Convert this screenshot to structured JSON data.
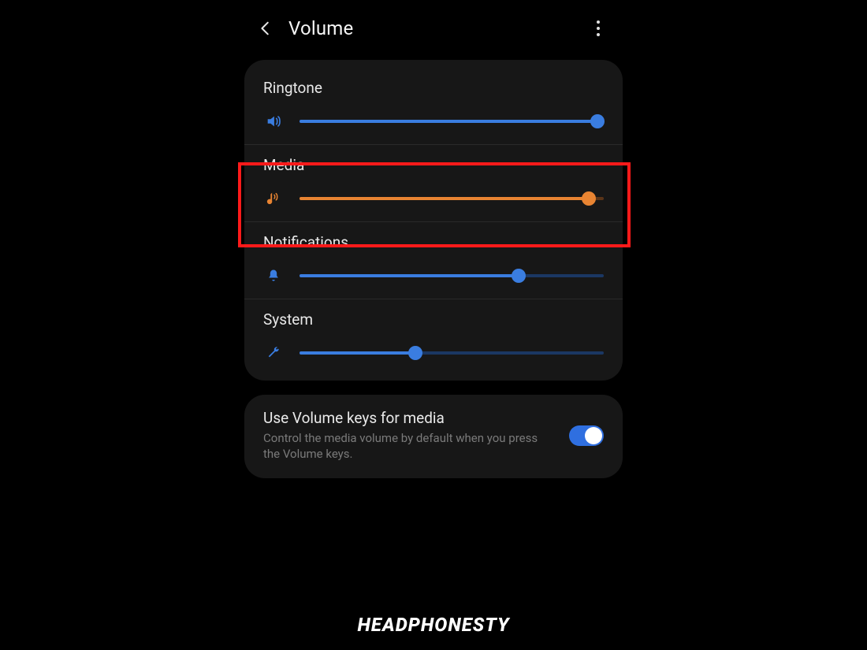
{
  "header": {
    "title": "Volume"
  },
  "sliders": {
    "ringtone": {
      "label": "Ringtone",
      "value": 98
    },
    "media": {
      "label": "Media",
      "value": 95
    },
    "notifications": {
      "label": "Notifications",
      "value": 72
    },
    "system": {
      "label": "System",
      "value": 38
    }
  },
  "option": {
    "title": "Use Volume keys for media",
    "subtitle": "Control the media volume by default when you press the Volume keys.",
    "enabled": true
  },
  "colors": {
    "blue": "#3a7de0",
    "orange": "#e88432",
    "highlight": "#ff1a1a"
  },
  "watermark": "HEADPHONESTY"
}
